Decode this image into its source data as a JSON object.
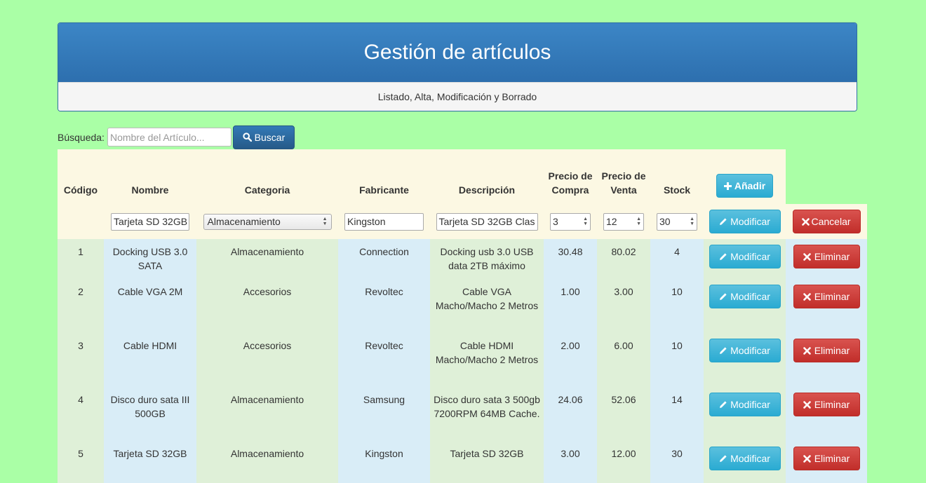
{
  "header": {
    "title": "Gestión de artículos",
    "subtitle": "Listado, Alta, Modificación y Borrado"
  },
  "search": {
    "label": "Búsqueda:",
    "placeholder": "Nombre del Artículo...",
    "button_label": "Buscar"
  },
  "table": {
    "headers": {
      "codigo": "Código",
      "nombre": "Nombre",
      "categoria": "Categoria",
      "fabricante": "Fabricante",
      "descripcion": "Descripción",
      "precio_compra": "Precio de Compra",
      "precio_venta": "Precio de Venta",
      "stock": "Stock",
      "add_button": "Añadir"
    },
    "edit_row": {
      "nombre": "Tarjeta SD 32GB",
      "categoria": "Almacenamiento",
      "fabricante": "Kingston",
      "descripcion": "Tarjeta SD 32GB Clas",
      "precio_compra": "3",
      "precio_venta": "12",
      "stock": "30",
      "modify_label": "Modificar",
      "cancel_label": "Cancelar"
    },
    "modify_label": "Modificar",
    "delete_label": "Eliminar",
    "rows": [
      {
        "codigo": "1",
        "nombre": "Docking USB 3.0 SATA",
        "categoria": "Almacenamiento",
        "fabricante": "Connection",
        "descripcion": "Docking usb 3.0 USB data 2TB máximo",
        "precio_compra": "30.48",
        "precio_venta": "80.02",
        "stock": "4"
      },
      {
        "codigo": "2",
        "nombre": "Cable VGA 2M",
        "categoria": "Accesorios",
        "fabricante": "Revoltec",
        "descripcion": "Cable VGA Macho/Macho 2 Metros",
        "precio_compra": "1.00",
        "precio_venta": "3.00",
        "stock": "10"
      },
      {
        "codigo": "3",
        "nombre": "Cable HDMI",
        "categoria": "Accesorios",
        "fabricante": "Revoltec",
        "descripcion": "Cable HDMI Macho/Macho 2 Metros",
        "precio_compra": "2.00",
        "precio_venta": "6.00",
        "stock": "10"
      },
      {
        "codigo": "4",
        "nombre": "Disco duro sata III 500GB",
        "categoria": "Almacenamiento",
        "fabricante": "Samsung",
        "descripcion": "Disco duro sata 3 500gb 7200RPM 64MB Cache.",
        "precio_compra": "24.06",
        "precio_venta": "52.06",
        "stock": "14"
      },
      {
        "codigo": "5",
        "nombre": "Tarjeta SD 32GB",
        "categoria": "Almacenamiento",
        "fabricante": "Kingston",
        "descripcion": "Tarjeta SD 32GB",
        "precio_compra": "3.00",
        "precio_venta": "12.00",
        "stock": "30"
      }
    ]
  },
  "colors": {
    "page_bg": "#aaffa6",
    "header_blue": "#337ab7",
    "info": "#5bc0de",
    "danger": "#d9534f",
    "warning_bg": "#fcf8e3",
    "success_bg": "#dff0d8",
    "info_bg": "#d9edf7"
  }
}
